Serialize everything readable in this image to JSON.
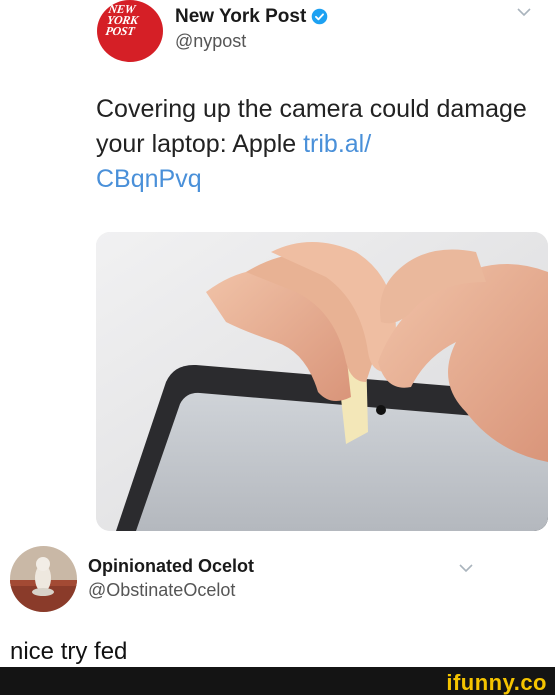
{
  "tweet": {
    "author_name": "New York Post",
    "author_handle": "@nypost",
    "logo_lines": [
      "NEW",
      "YORK",
      "POST"
    ],
    "text": "Covering up the camera could damage your laptop: Apple ",
    "link_text": "trib.al/\nCBqnPvq",
    "verified_color": "#1da1f2",
    "icons": [
      "verified-icon",
      "chevron-down-icon"
    ]
  },
  "reply": {
    "author_name": "Opinionated Ocelot",
    "author_handle": "@ObstinateOcelot",
    "text": "nice try fed"
  },
  "watermark": {
    "text": "ifunny.co"
  },
  "colors": {
    "nyp_red": "#d51f26",
    "link_blue": "#4a90d9",
    "watermark_yellow": "#f5c400"
  }
}
